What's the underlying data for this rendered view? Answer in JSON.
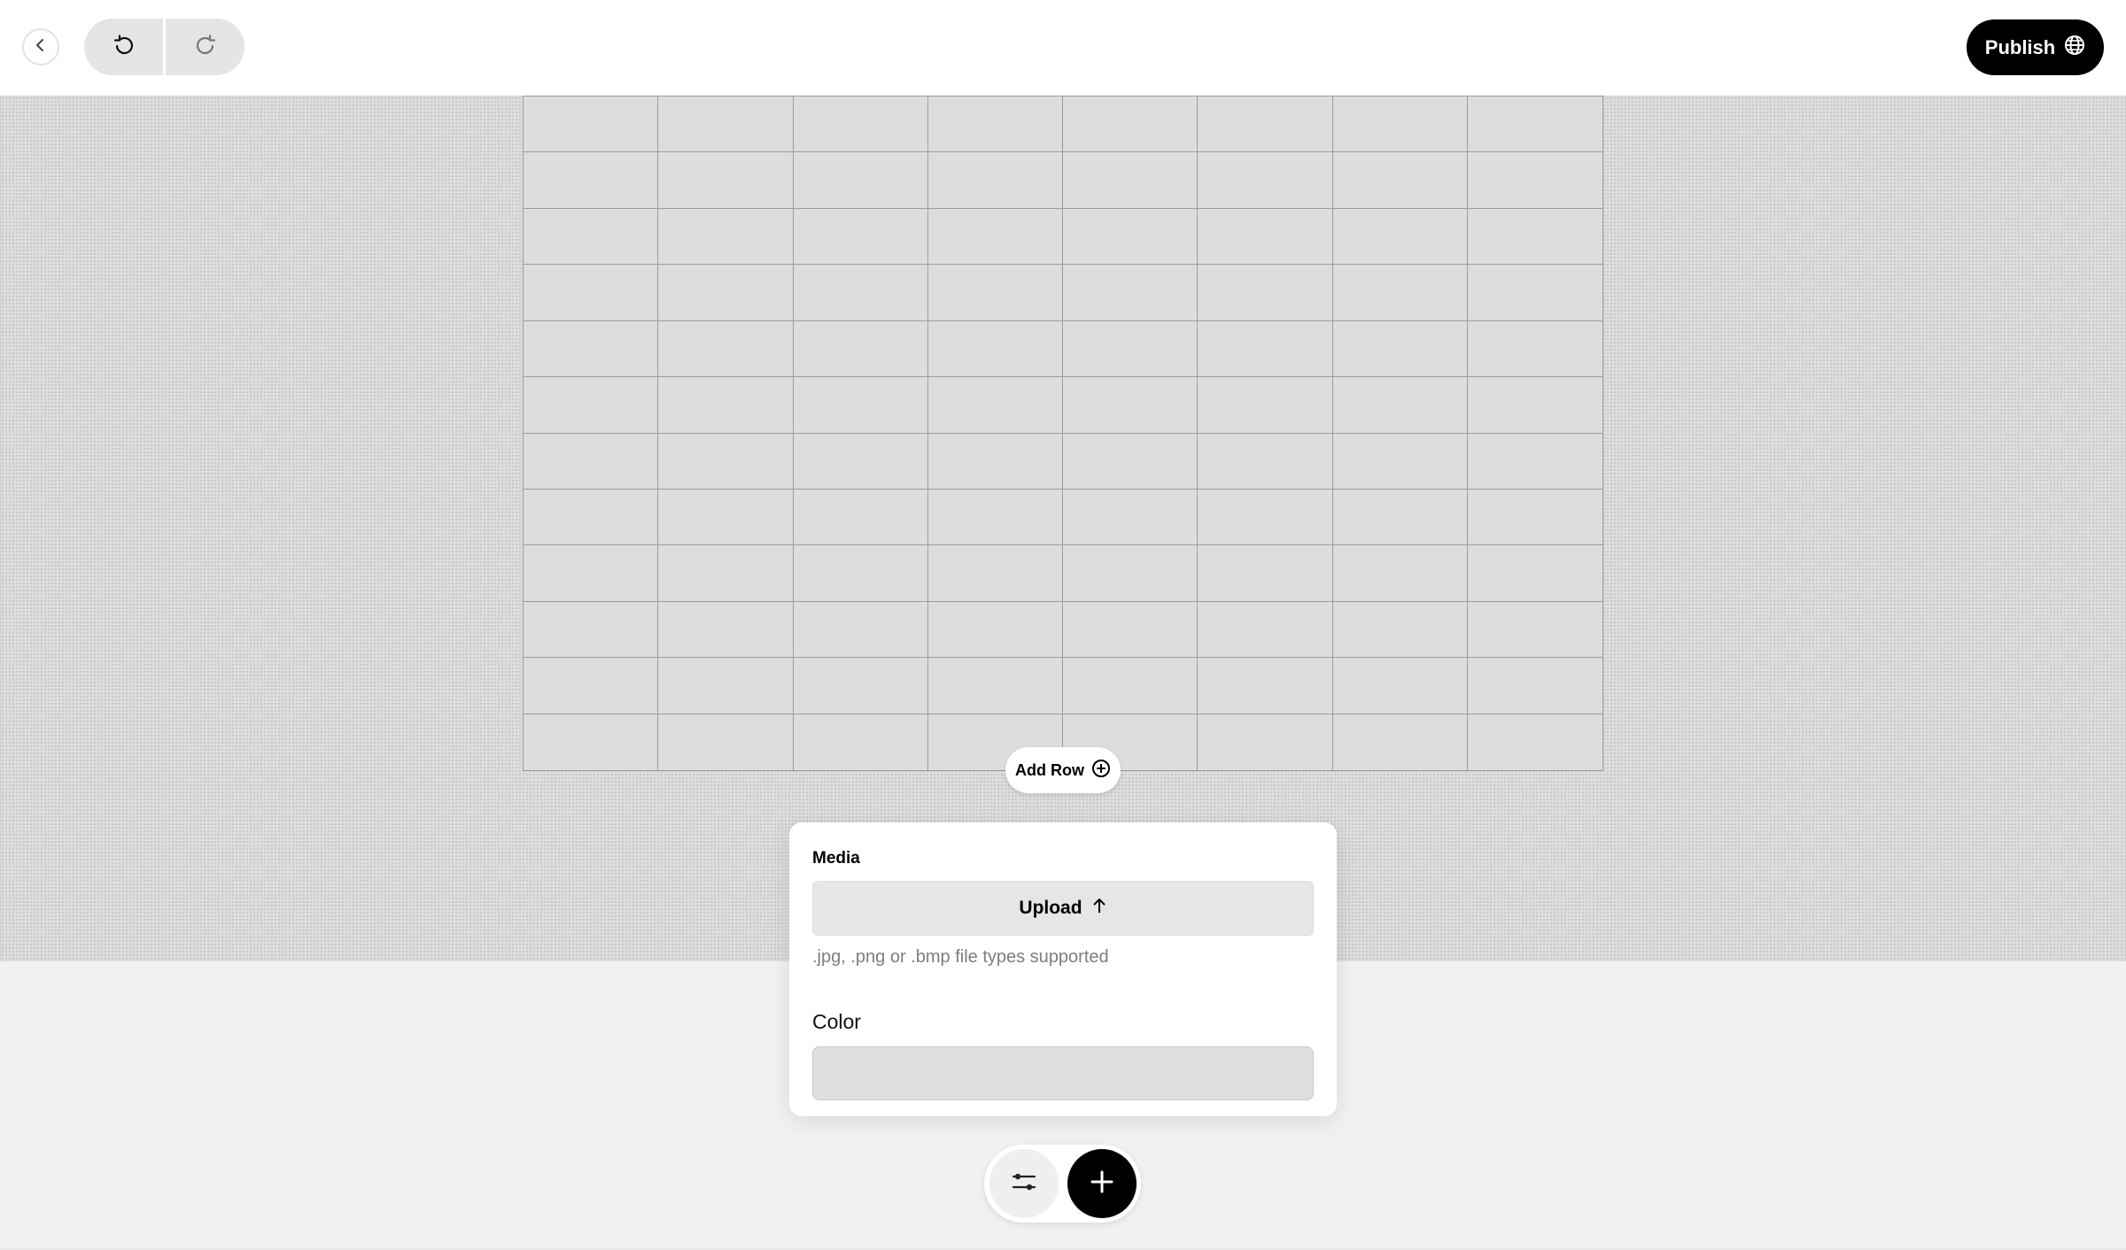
{
  "header": {
    "back_icon": "chevron-left-icon",
    "undo_icon": "undo-icon",
    "redo_icon": "redo-icon",
    "publish_label": "Publish",
    "publish_icon": "globe-icon"
  },
  "canvas": {
    "grid": {
      "columns": 8,
      "rows": 12
    },
    "add_row_label": "Add Row",
    "add_row_icon": "plus-circle-icon"
  },
  "panel": {
    "media_label": "Media",
    "upload_label": "Upload",
    "upload_icon": "arrow-up-icon",
    "upload_hint": ".jpg, .png or .bmp file types supported",
    "color_label": "Color",
    "color_value": "#dfdfde"
  },
  "toolbar": {
    "settings_icon": "sliders-icon",
    "add_icon": "plus-icon"
  },
  "colors": {
    "accent": "#000000",
    "canvas_bg": "#dddddd",
    "page_bg": "#f1f1f1",
    "grid_line": "#9c9c9c"
  }
}
